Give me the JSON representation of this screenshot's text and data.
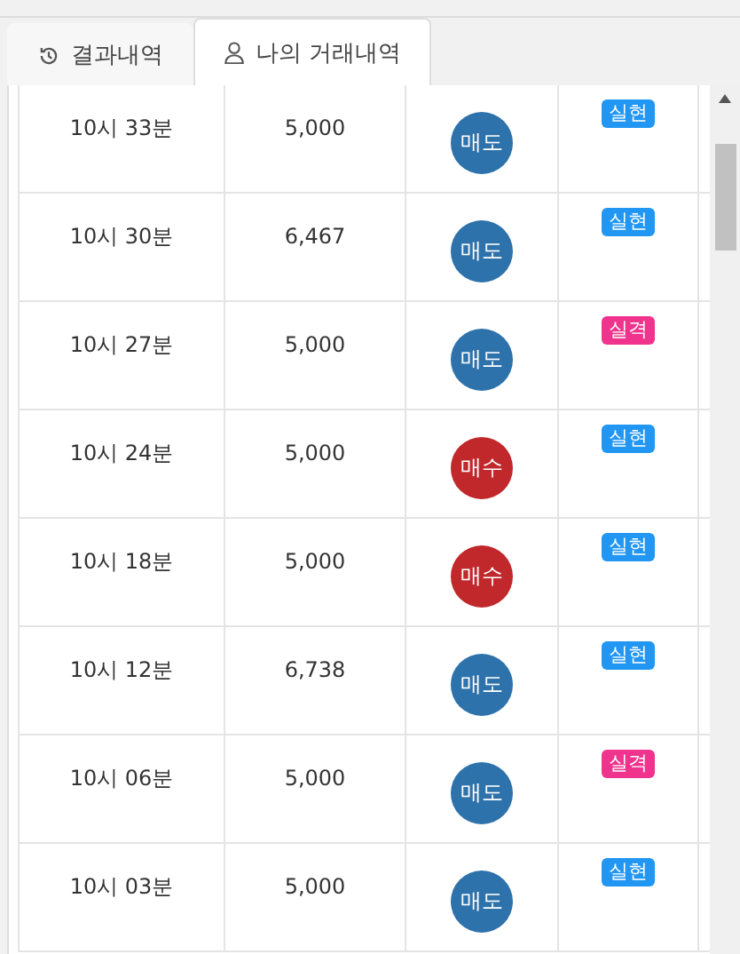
{
  "tabs": [
    {
      "label": "결과내역",
      "selected": false
    },
    {
      "label": "나의 거래내역",
      "selected": true
    }
  ],
  "trades": [
    {
      "time": "10시 33분",
      "amount": "5,000",
      "side": {
        "kind": "sell",
        "label": "매도"
      },
      "result": {
        "kind": "win",
        "label": "실현"
      }
    },
    {
      "time": "10시 30분",
      "amount": "6,467",
      "side": {
        "kind": "sell",
        "label": "매도"
      },
      "result": {
        "kind": "win",
        "label": "실현"
      }
    },
    {
      "time": "10시 27분",
      "amount": "5,000",
      "side": {
        "kind": "sell",
        "label": "매도"
      },
      "result": {
        "kind": "lose",
        "label": "실격"
      }
    },
    {
      "time": "10시 24분",
      "amount": "5,000",
      "side": {
        "kind": "buy",
        "label": "매수"
      },
      "result": {
        "kind": "win",
        "label": "실현"
      }
    },
    {
      "time": "10시 18분",
      "amount": "5,000",
      "side": {
        "kind": "buy",
        "label": "매수"
      },
      "result": {
        "kind": "win",
        "label": "실현"
      }
    },
    {
      "time": "10시 12분",
      "amount": "6,738",
      "side": {
        "kind": "sell",
        "label": "매도"
      },
      "result": {
        "kind": "win",
        "label": "실현"
      }
    },
    {
      "time": "10시 06분",
      "amount": "5,000",
      "side": {
        "kind": "sell",
        "label": "매도"
      },
      "result": {
        "kind": "lose",
        "label": "실격"
      }
    },
    {
      "time": "10시 03분",
      "amount": "5,000",
      "side": {
        "kind": "sell",
        "label": "매도"
      },
      "result": {
        "kind": "win",
        "label": "실현"
      }
    }
  ]
}
